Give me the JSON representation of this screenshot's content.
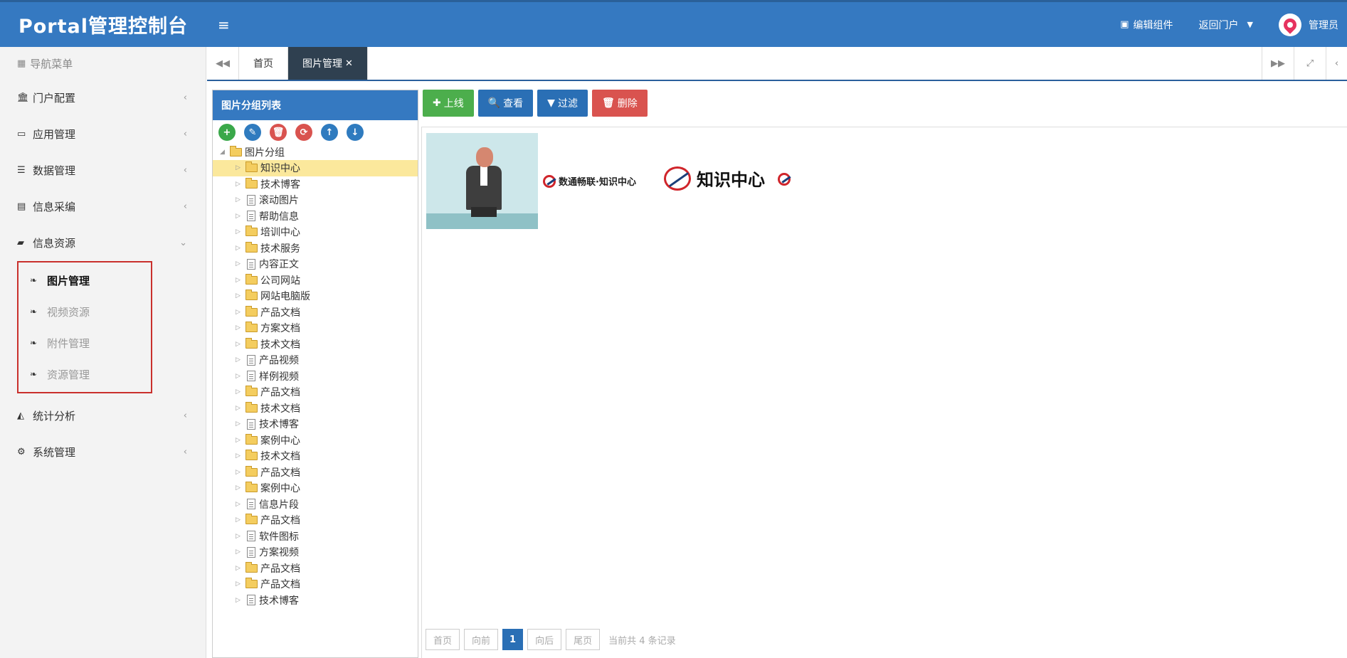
{
  "header": {
    "brand": "Portal管理控制台",
    "edit_widget": "编辑组件",
    "back_portal": "返回门户",
    "user": "管理员",
    "accent": "#3579c1"
  },
  "sidebar": {
    "title": "导航菜单",
    "items": [
      {
        "label": "门户配置",
        "icon": "bank-icon"
      },
      {
        "label": "应用管理",
        "icon": "laptop-icon"
      },
      {
        "label": "数据管理",
        "icon": "list-icon"
      },
      {
        "label": "信息采编",
        "icon": "card-icon"
      },
      {
        "label": "信息资源",
        "icon": "book-icon"
      },
      {
        "label": "统计分析",
        "icon": "area-chart-icon"
      },
      {
        "label": "系统管理",
        "icon": "cogs-icon"
      }
    ],
    "submenu": [
      "图片管理",
      "视频资源",
      "附件管理",
      "资源管理"
    ]
  },
  "tabs": {
    "home": "首页",
    "active": "图片管理"
  },
  "tree": {
    "title": "图片分组列表",
    "root": "图片分组",
    "nodes": [
      {
        "label": "知识中心",
        "type": "folder"
      },
      {
        "label": "技术博客",
        "type": "folder"
      },
      {
        "label": "滚动图片",
        "type": "doc"
      },
      {
        "label": "帮助信息",
        "type": "doc"
      },
      {
        "label": "培训中心",
        "type": "folder"
      },
      {
        "label": "技术服务",
        "type": "folder"
      },
      {
        "label": "内容正文",
        "type": "doc"
      },
      {
        "label": "公司网站",
        "type": "folder"
      },
      {
        "label": "网站电脑版",
        "type": "folder"
      },
      {
        "label": "产品文档",
        "type": "folder"
      },
      {
        "label": "方案文档",
        "type": "folder"
      },
      {
        "label": "技术文档",
        "type": "folder"
      },
      {
        "label": "产品视频",
        "type": "doc"
      },
      {
        "label": "样例视频",
        "type": "doc"
      },
      {
        "label": "产品文档",
        "type": "folder"
      },
      {
        "label": "技术文档",
        "type": "folder"
      },
      {
        "label": "技术博客",
        "type": "doc"
      },
      {
        "label": "案例中心",
        "type": "folder"
      },
      {
        "label": "技术文档",
        "type": "folder"
      },
      {
        "label": "产品文档",
        "type": "folder"
      },
      {
        "label": "案例中心",
        "type": "folder"
      },
      {
        "label": "信息片段",
        "type": "doc"
      },
      {
        "label": "产品文档",
        "type": "folder"
      },
      {
        "label": "软件图标",
        "type": "doc"
      },
      {
        "label": "方案视频",
        "type": "doc"
      },
      {
        "label": "产品文档",
        "type": "folder"
      },
      {
        "label": "产品文档",
        "type": "folder"
      },
      {
        "label": "技术博客",
        "type": "doc"
      }
    ]
  },
  "toolbar": {
    "upload": "上线",
    "view": "查看",
    "filter": "过滤",
    "delete": "删除"
  },
  "images": {
    "logo1_text": "数通畅联·知识中心",
    "logo2_text": "知识中心"
  },
  "pager": {
    "first": "首页",
    "prev": "向前",
    "current": "1",
    "next": "向后",
    "last": "尾页",
    "info": "当前共 4 条记录"
  }
}
